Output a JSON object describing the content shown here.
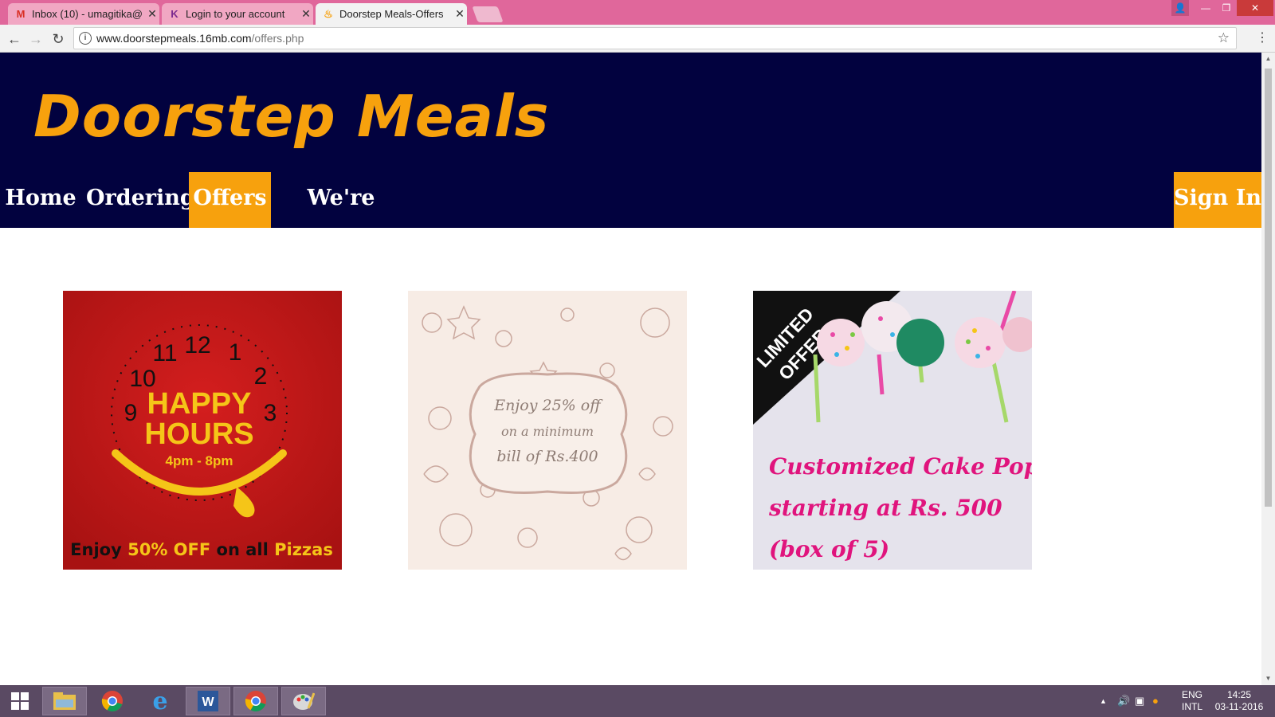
{
  "browser": {
    "tabs": [
      {
        "title": "Inbox (10) - umagitika@",
        "icon": "gmail-icon",
        "active": false
      },
      {
        "title": "Login to your account",
        "icon": "site-icon",
        "active": false
      },
      {
        "title": "Doorstep Meals-Offers",
        "icon": "orange-favicon",
        "active": true
      }
    ],
    "url_host": "www.doorstepmeals.16mb.com",
    "url_path": "/offers.php"
  },
  "site": {
    "logo": "Doorstep Meals",
    "nav": [
      {
        "label": "Home",
        "active": false
      },
      {
        "label": "Ordering",
        "active": false
      },
      {
        "label": "Offers",
        "active": true
      },
      {
        "label": "We're Hiring",
        "active": false
      }
    ],
    "sign_in": "Sign In",
    "colors": {
      "header_bg": "#02023f",
      "accent": "#f7a10d"
    }
  },
  "offers": [
    {
      "title_line1": "HAPPY",
      "title_line2": "HOURS",
      "time": "4pm - 8pm",
      "clock_numbers": [
        "12",
        "1",
        "2",
        "3",
        "9",
        "10",
        "11"
      ],
      "footer_plain1": "Enjoy ",
      "footer_highlight1": "50% OFF",
      "footer_plain2": " on all ",
      "footer_highlight2": "Pizzas"
    },
    {
      "line1": "Enjoy 25% off",
      "line2": "on a minimum",
      "line3": "bill of Rs.400"
    },
    {
      "badge_line1": "LIMITED",
      "badge_line2": "OFFER",
      "line1": "Customized Cake Pops",
      "line2": "starting at Rs. 500",
      "line3": "(box of 5)"
    }
  ],
  "taskbar": {
    "lang_top": "ENG",
    "lang_bottom": "INTL",
    "time": "14:25",
    "date": "03-11-2016"
  }
}
